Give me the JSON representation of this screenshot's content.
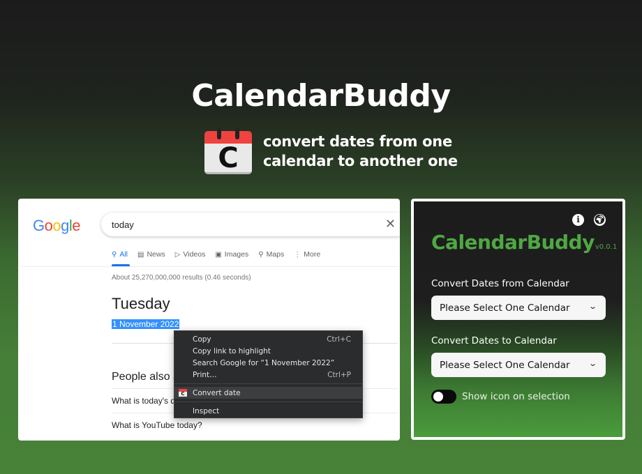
{
  "hero": {
    "title": "CalendarBuddy",
    "icon_letter": "C",
    "tagline_line1": "convert dates from one",
    "tagline_line2": "calendar to another one"
  },
  "google": {
    "logo_letters": [
      {
        "ch": "G",
        "color": "#4285f4"
      },
      {
        "ch": "o",
        "color": "#ea4335"
      },
      {
        "ch": "o",
        "color": "#fbbc05"
      },
      {
        "ch": "g",
        "color": "#4285f4"
      },
      {
        "ch": "l",
        "color": "#34a853"
      },
      {
        "ch": "e",
        "color": "#ea4335"
      }
    ],
    "search_value": "today",
    "clear_icon": "✕",
    "tabs": [
      {
        "icon": "search-icon",
        "glyph": "⚲",
        "label": "All",
        "active": true
      },
      {
        "icon": "news-icon",
        "glyph": "▤",
        "label": "News"
      },
      {
        "icon": "video-icon",
        "glyph": "▷",
        "label": "Videos"
      },
      {
        "icon": "image-icon",
        "glyph": "▣",
        "label": "Images"
      },
      {
        "icon": "map-pin-icon",
        "glyph": "⚲",
        "label": "Maps"
      },
      {
        "icon": "more-icon",
        "glyph": "⋮",
        "label": "More"
      }
    ],
    "result_stats": "About 25,270,000,000 results (0.46 seconds)",
    "answer_day": "Tuesday",
    "answer_date": "1 November 2022",
    "people_also_ask": "People also ask",
    "questions": [
      "What is today's date?",
      "What is YouTube today?"
    ]
  },
  "context_menu": {
    "items": [
      {
        "label": "Copy",
        "shortcut": "Ctrl+C"
      },
      {
        "label": "Copy link to highlight",
        "shortcut": ""
      },
      {
        "label": "Search Google for “1 November 2022”",
        "shortcut": ""
      },
      {
        "label": "Print…",
        "shortcut": "Ctrl+P"
      },
      {
        "label": "Convert date",
        "shortcut": "",
        "icon": "calendarbuddy-icon"
      },
      {
        "label": "Inspect",
        "shortcut": ""
      }
    ]
  },
  "extension": {
    "title": "CalendarBuddy",
    "version": "v0.0.1",
    "from_label": "Convert Dates from Calendar",
    "from_select": "Please Select One Calendar",
    "to_label": "Convert Dates to Calendar",
    "to_select": "Please Select One Calendar",
    "toggle_label": "Show icon on selection",
    "toggle_on": false,
    "colors": {
      "accent": "#4fa843"
    }
  }
}
